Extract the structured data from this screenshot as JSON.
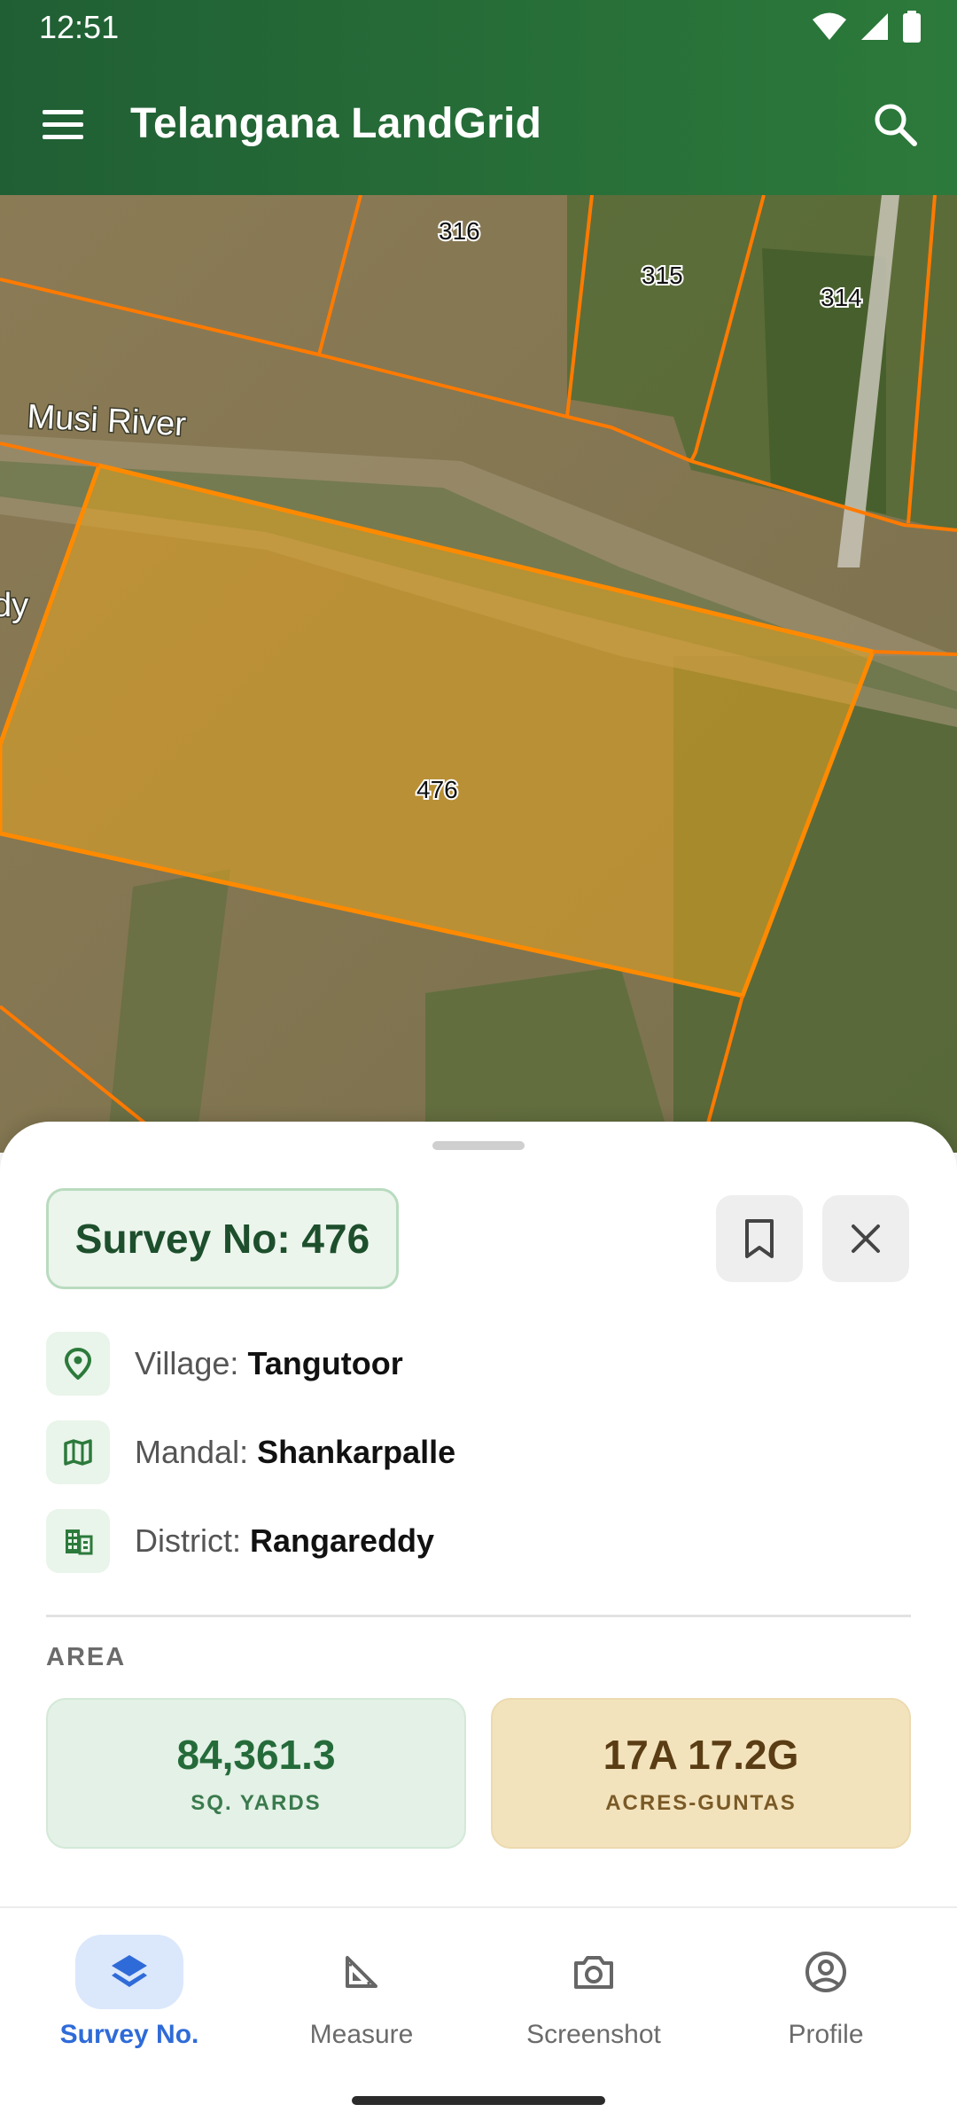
{
  "status_bar": {
    "time": "12:51"
  },
  "app_bar": {
    "title": "Telangana LandGrid"
  },
  "map": {
    "labels": {
      "parcel_316": "316",
      "parcel_315": "315",
      "parcel_314": "314",
      "parcel_476": "476",
      "river": "Musi River",
      "edge_text": "dy"
    },
    "colors": {
      "parcel_outline": "#ff8a00",
      "selected_fill": "#e8a521"
    }
  },
  "sheet": {
    "survey_label": "Survey No: 476",
    "village": {
      "label": "Village:",
      "value": "Tangutoor"
    },
    "mandal": {
      "label": "Mandal:",
      "value": "Shankarpalle"
    },
    "district": {
      "label": "District:",
      "value": "Rangareddy"
    },
    "area_heading": "AREA",
    "area_yards": {
      "value": "84,361.3",
      "unit": "SQ. YARDS"
    },
    "area_acres": {
      "value": "17A 17.2G",
      "unit": "ACRES-GUNTAS"
    }
  },
  "bottom_nav": {
    "items": [
      {
        "label": "Survey No.",
        "icon": "layers-icon",
        "active": true
      },
      {
        "label": "Measure",
        "icon": "ruler-triangle-icon",
        "active": false
      },
      {
        "label": "Screenshot",
        "icon": "camera-icon",
        "active": false
      },
      {
        "label": "Profile",
        "icon": "account-circle-icon",
        "active": false
      }
    ]
  },
  "theme": {
    "primary": "#2c7a3b",
    "nav_active": "#2f6bd8"
  }
}
